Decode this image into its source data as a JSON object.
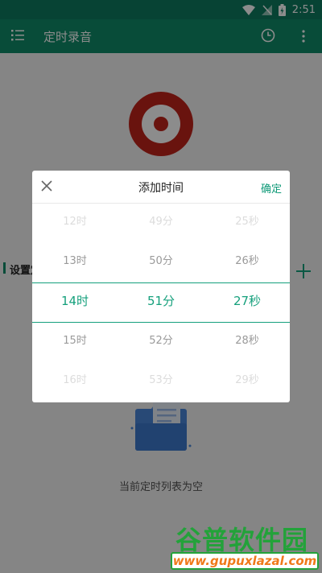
{
  "status": {
    "time": "2:51"
  },
  "appbar": {
    "title": "定时录音"
  },
  "main": {
    "section_title": "设置定",
    "empty_text": "当前定时列表为空"
  },
  "dialog": {
    "title": "添加时间",
    "confirm_label": "确定",
    "hours": [
      "12时",
      "13时",
      "14时",
      "15时",
      "16时"
    ],
    "minutes": [
      "49分",
      "50分",
      "51分",
      "52分",
      "53分"
    ],
    "seconds": [
      "25秒",
      "26秒",
      "27秒",
      "28秒",
      "29秒"
    ],
    "selected_index": 2
  },
  "watermark": {
    "name": "谷普软件园",
    "url": "www.gupuxlazal.com"
  },
  "colors": {
    "primary": "#0f8a68",
    "accent": "#15a07c",
    "record": "#c0231b"
  }
}
